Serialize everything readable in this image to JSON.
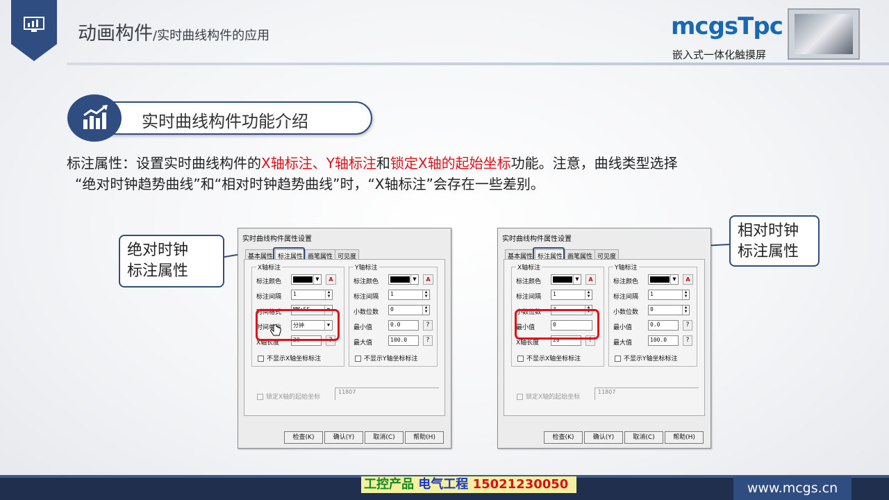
{
  "header": {
    "title": "动画构件",
    "subtitle": "/实时曲线构件的应用",
    "logo_text": "mcgsTpc",
    "logo_subtitle": "嵌入式一体化触摸屏"
  },
  "section": {
    "title": "实时曲线构件功能介绍"
  },
  "description": {
    "p1": "标注属性：设置实时曲线构件的",
    "r1": "X轴标注、Y轴标注",
    "p2": "和",
    "r2": "锁定X轴的起始坐标",
    "p3": "功能。注意，曲线类型选择",
    "line2": "“绝对时钟趋势曲线”和“相对时钟趋势曲线”时，“X轴标注”会存在一些差别。"
  },
  "callouts": {
    "left_l1": "绝对时钟",
    "left_l2": "标注属性",
    "right_l1": "相对时钟",
    "right_l2": "标注属性"
  },
  "dialog_left": {
    "title": "实时曲线构件属性设置",
    "tabs": [
      "基本属性",
      "标注属性",
      "画笔属性",
      "可见度"
    ],
    "x_group": "X轴标注",
    "x_color_label": "标注颜色",
    "x_interval_label": "标注间隔",
    "x_interval": "1",
    "time_format_label": "时间格式",
    "time_format": "MM:SS",
    "time_unit_label": "时间单位",
    "time_unit": "分钟",
    "x_length_label": "X轴长度",
    "x_length": "20",
    "x_hide": "不显示X轴坐标标注",
    "y_group": "Y轴标注",
    "y_color_label": "标注颜色",
    "y_interval_label": "标注间隔",
    "y_interval": "1",
    "y_decimals_label": "小数位数",
    "y_decimals": "0",
    "y_min_label": "最小值",
    "y_min": "0.0",
    "y_max_label": "最大值",
    "y_max": "100.0",
    "y_hide": "不显示Y轴坐标标注",
    "lock_label": "锁定X轴的起始坐标",
    "lock_value": "11807",
    "buttons": [
      "检查(K)",
      "确认(Y)",
      "取消(C)",
      "帮助(H)"
    ]
  },
  "dialog_right": {
    "title": "实时曲线构件属性设置",
    "tabs": [
      "基本属性",
      "标注属性",
      "画笔属性",
      "可见度"
    ],
    "x_group": "X轴标注",
    "x_color_label": "标注颜色",
    "x_interval_label": "标注间隔",
    "x_interval": "1",
    "x_decimals_label": "小数位数",
    "x_decimals": "3",
    "x_min_label": "最小值",
    "x_min": "0",
    "x_length_label": "X轴长度",
    "x_length": "20",
    "x_hide": "不显示X轴坐标标注",
    "y_group": "Y轴标注",
    "y_color_label": "标注颜色",
    "y_interval_label": "标注间隔",
    "y_interval": "1",
    "y_decimals_label": "小数位数",
    "y_decimals": "0",
    "y_min_label": "最小值",
    "y_min": "0.0",
    "y_max_label": "最大值",
    "y_max": "100.0",
    "y_hide": "不显示Y轴坐标标注",
    "lock_label": "锁定X轴的起始坐标",
    "lock_value": "11807",
    "buttons": [
      "检查(K)",
      "确认(Y)",
      "取消(C)",
      "帮助(H)"
    ]
  },
  "footer": {
    "ad_a": "工控产品",
    "ad_b": "电气工程",
    "ad_c": "15021230050",
    "url": "www.mcgs.cn"
  },
  "colors": {
    "primary": "#2f4d80",
    "highlight_red": "#e0101a",
    "logo_blue": "#1768b5"
  },
  "icons": [
    "monitor-chart-icon",
    "bar-chart-trend-icon",
    "hand-cursor-icon"
  ]
}
